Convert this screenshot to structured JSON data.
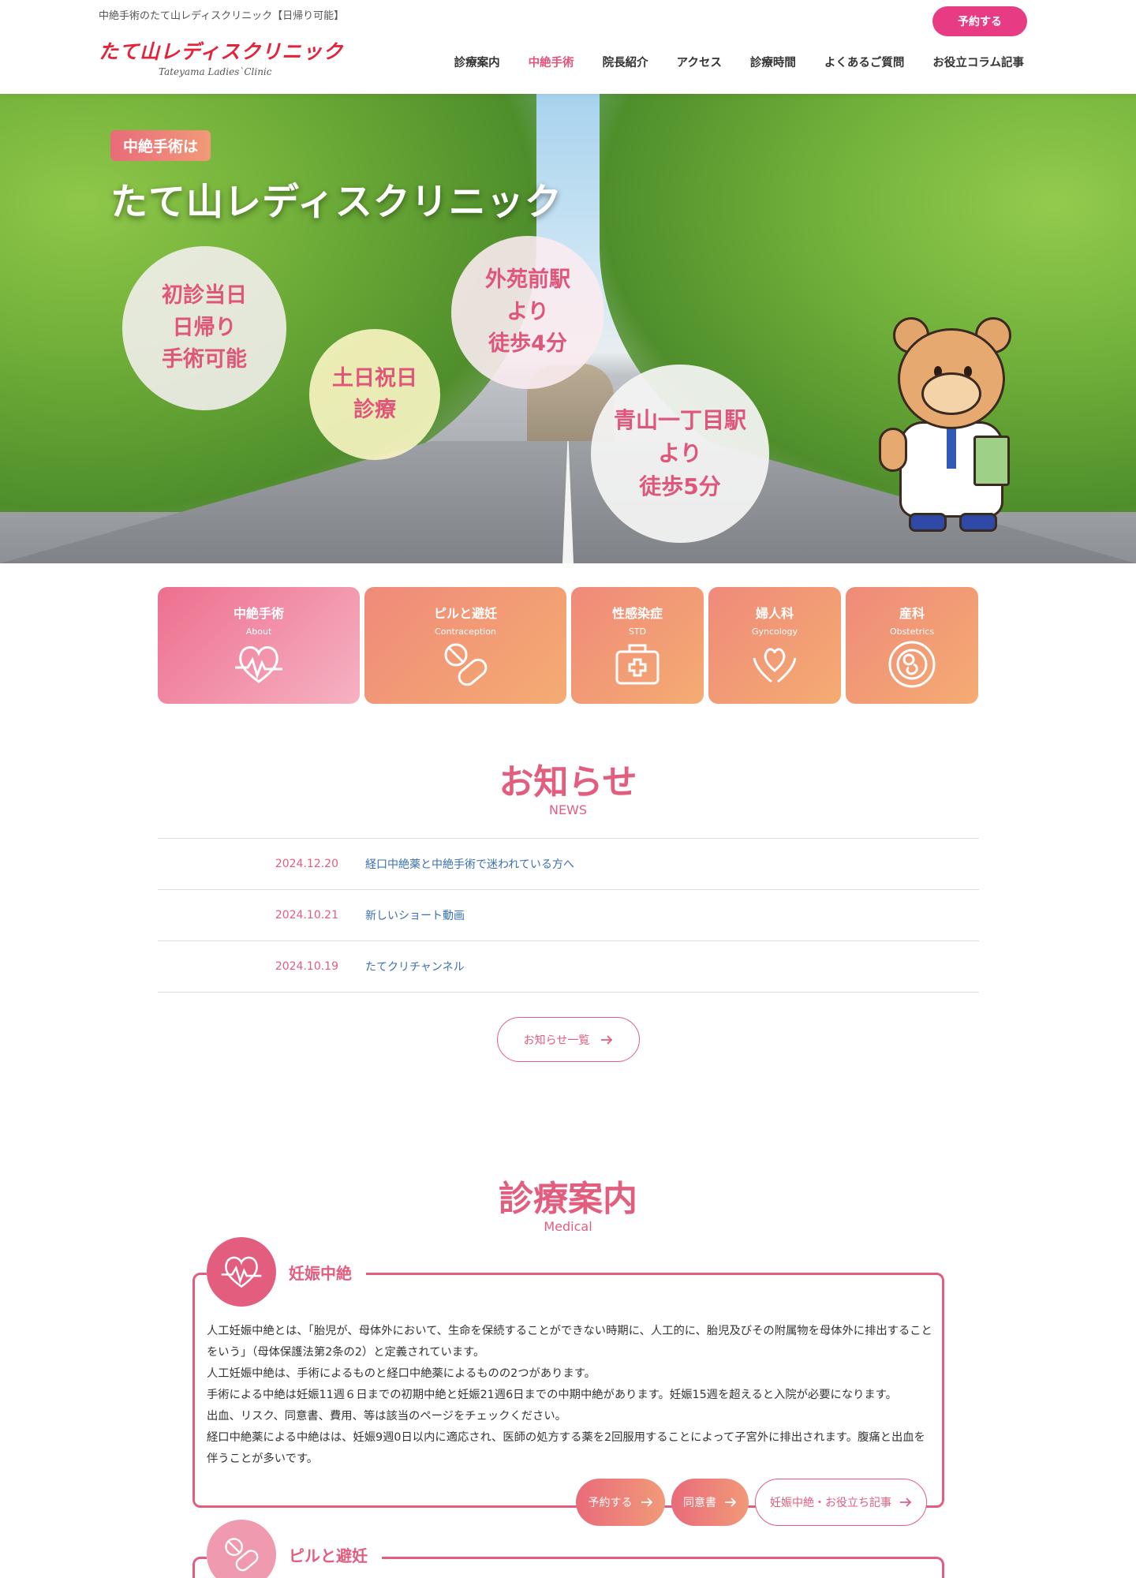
{
  "header": {
    "tagline": "中絶手術のたて山レディスクリニック【日帰り可能】",
    "logo_jp": "たて山レディスクリニック",
    "logo_en": "Tateyama Ladies`Clinic",
    "reserve_label": "予約する",
    "nav": [
      {
        "label": "診療案内"
      },
      {
        "label": "中絶手術"
      },
      {
        "label": "院長紹介"
      },
      {
        "label": "アクセス"
      },
      {
        "label": "診療時間"
      },
      {
        "label": "よくあるご質問"
      },
      {
        "label": "お役立コラム記事"
      }
    ]
  },
  "hero": {
    "badge": "中絶手術は",
    "title": "たて山レディスクリニック",
    "bubbles": [
      [
        "初診当日",
        "日帰り",
        "手術可能"
      ],
      [
        "土日祝日",
        "診療"
      ],
      [
        "外苑前駅",
        "より",
        "徒歩4分"
      ],
      [
        "青山一丁目駅",
        "より",
        "徒歩5分"
      ]
    ]
  },
  "categories": [
    {
      "title": "中絶手術",
      "sub": "About",
      "icon": "heartbeat-icon"
    },
    {
      "title": "ピルと避妊",
      "sub": "Contraception",
      "icon": "pill-icon"
    },
    {
      "title": "性感染症",
      "sub": "STD",
      "icon": "medical-kit-icon"
    },
    {
      "title": "婦人科",
      "sub": "Gyncology",
      "icon": "heart-hands-icon"
    },
    {
      "title": "産科",
      "sub": "Obstetrics",
      "icon": "fetus-icon"
    }
  ],
  "news": {
    "title": "お知らせ",
    "subtitle": "NEWS",
    "items": [
      {
        "date": "2024.12.20",
        "text": "経口中絶薬と中絶手術で迷われている方へ"
      },
      {
        "date": "2024.10.21",
        "text": "新しいショート動画"
      },
      {
        "date": "2024.10.19",
        "text": "たてクリチャンネル"
      }
    ],
    "more_label": "お知らせ一覧"
  },
  "medical": {
    "title": "診療案内",
    "subtitle": "Medical",
    "sections": [
      {
        "label": "妊娠中絶",
        "icon": "heartbeat-icon",
        "paragraphs": [
          "人工妊娠中絶とは、「胎児が、母体外において、生命を保続することができない時期に、人工的に、胎児及びその附属物を母体外に排出することをいう」（母体保護法第2条の2）と定義されています。",
          "人工妊娠中絶は、手術によるものと経口中絶薬によるものの2つがあります。",
          "手術による中絶は妊娠11週６日までの初期中絶と妊娠21週6日までの中期中絶があります。妊娠15週を超えると入院が必要になります。",
          "出血、リスク、同意書、費用、等は該当のページをチェックください。",
          "経口中絶薬による中絶はは、妊娠9週0日以内に適応され、医師の処方する薬を2回服用することによって子宮外に排出されます。腹痛と出血を伴うことが多いです。"
        ],
        "buttons": [
          {
            "label": "予約する"
          },
          {
            "label": "同意書"
          },
          {
            "label": "妊娠中絶・お役立ち記事"
          }
        ]
      },
      {
        "label": "ピルと避妊",
        "icon": "pill-icon"
      }
    ]
  },
  "colors": {
    "accent": "#e35d7f",
    "reserve": "#e73c84",
    "link": "#3a6fb3"
  }
}
